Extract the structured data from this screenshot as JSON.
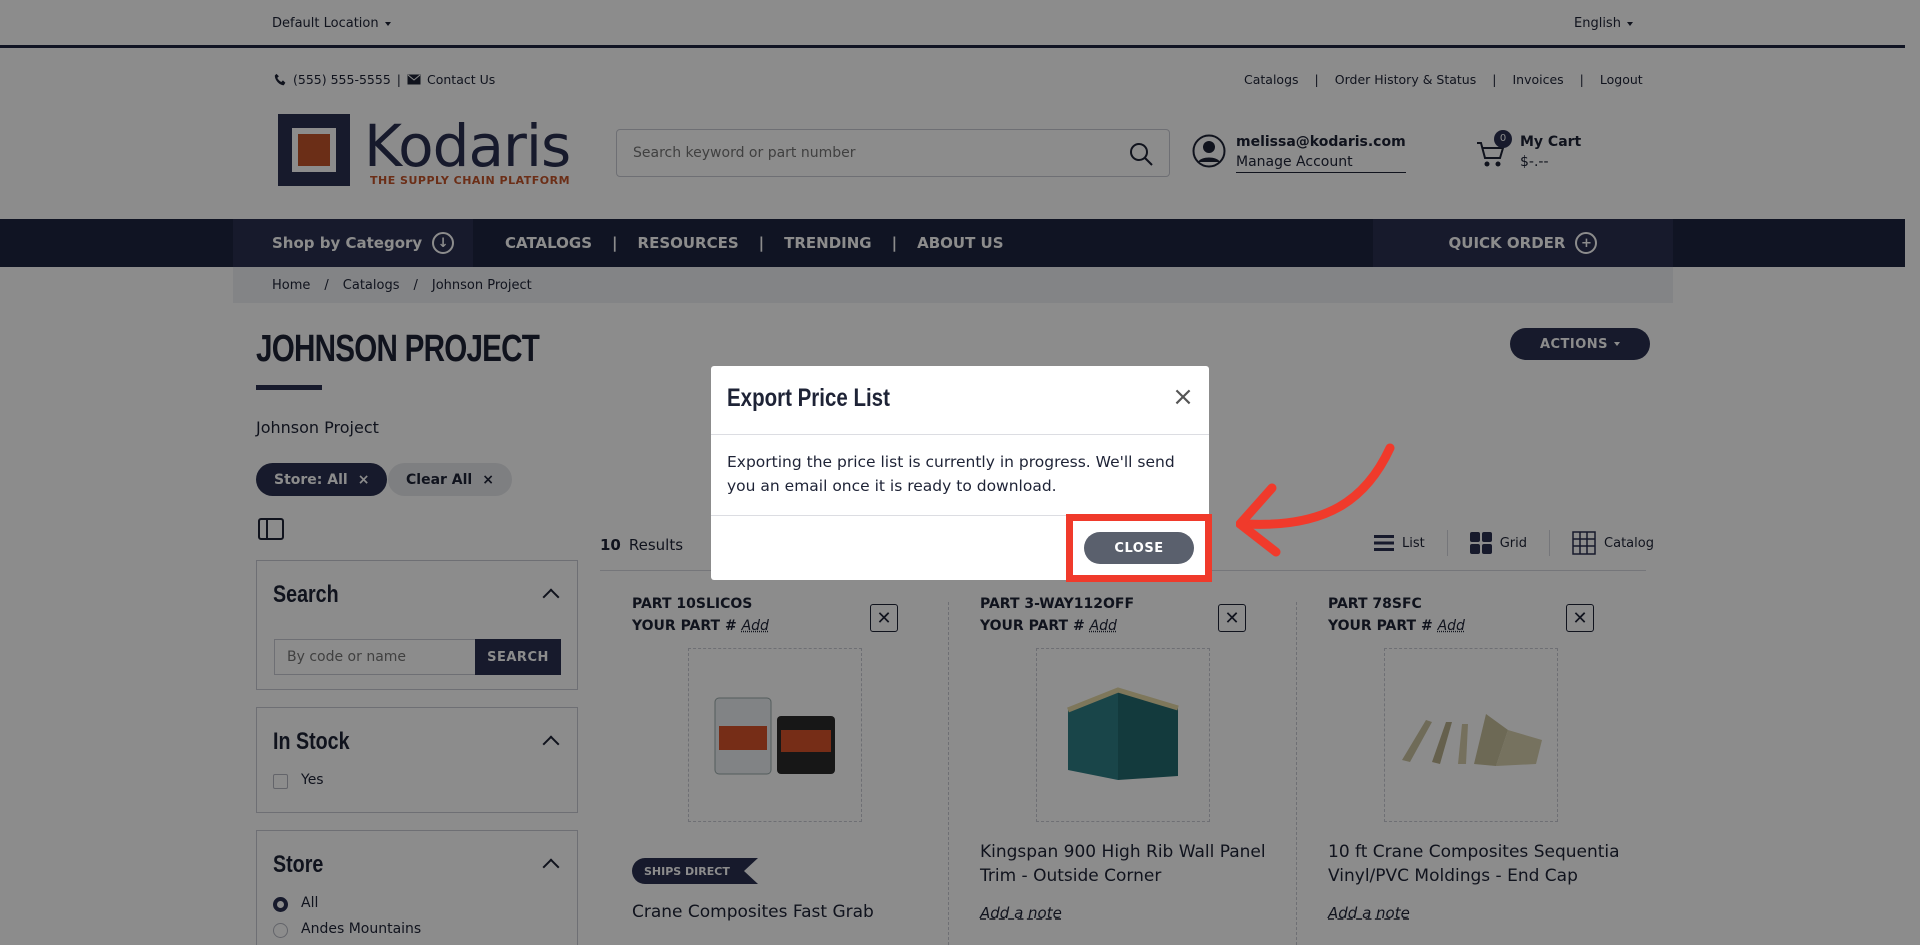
{
  "topbar": {
    "location": "Default Location",
    "language": "English"
  },
  "contact": {
    "phone": "(555) 555-5555",
    "contact_label": "Contact Us"
  },
  "top_links": [
    "Catalogs",
    "Order History & Status",
    "Invoices",
    "Logout"
  ],
  "logo": {
    "name": "Kodaris",
    "tagline": "THE SUPPLY CHAIN PLATFORM"
  },
  "search": {
    "placeholder": "Search keyword or part number"
  },
  "account": {
    "email": "melissa@kodaris.com",
    "manage_label": "Manage Account"
  },
  "cart": {
    "count": "0",
    "title": "My Cart",
    "amount": "$-.--"
  },
  "nav": {
    "shop_label": "Shop by Category",
    "links": [
      "CATALOGS",
      "RESOURCES",
      "TRENDING",
      "ABOUT US"
    ],
    "quick_order": "QUICK ORDER"
  },
  "breadcrumb": [
    "Home",
    "Catalogs",
    "Johnson Project"
  ],
  "page": {
    "title": "JOHNSON PROJECT",
    "subtitle": "Johnson Project",
    "actions_label": "ACTIONS"
  },
  "chips": {
    "store": "Store: All",
    "clear": "Clear All"
  },
  "filters": {
    "search": {
      "title": "Search",
      "placeholder": "By code or name",
      "button": "SEARCH"
    },
    "in_stock": {
      "title": "In Stock",
      "option": "Yes"
    },
    "store": {
      "title": "Store",
      "options": [
        "All",
        "Andes Mountains"
      ]
    }
  },
  "results": {
    "count": "10",
    "label": "Results"
  },
  "views": [
    "List",
    "Grid",
    "Catalog"
  ],
  "products": [
    {
      "part": "PART 10SLICOS",
      "your_part_label": "YOUR PART #",
      "add_label": "Add",
      "badge": "SHIPS DIRECT",
      "name": "Crane Composites Fast Grab",
      "note": ""
    },
    {
      "part": "PART 3-WAY112OFF",
      "your_part_label": "YOUR PART #",
      "add_label": "Add",
      "badge": "",
      "name": "Kingspan 900 High Rib Wall Panel Trim - Outside Corner",
      "note": "Add a note"
    },
    {
      "part": "PART 78SFC",
      "your_part_label": "YOUR PART #",
      "add_label": "Add",
      "badge": "",
      "name": "10 ft Crane Composites Sequentia Vinyl/PVC Moldings - End Cap",
      "note": "Add a note"
    }
  ],
  "modal": {
    "title": "Export Price List",
    "body": "Exporting the price list is currently in progress. We'll send you an email once it is ready to download.",
    "close_label": "CLOSE"
  },
  "colors": {
    "navy": "#1e2640",
    "accent_orange": "#c4542a",
    "annotation_red": "#f03a2b",
    "close_btn": "#5a606d"
  }
}
